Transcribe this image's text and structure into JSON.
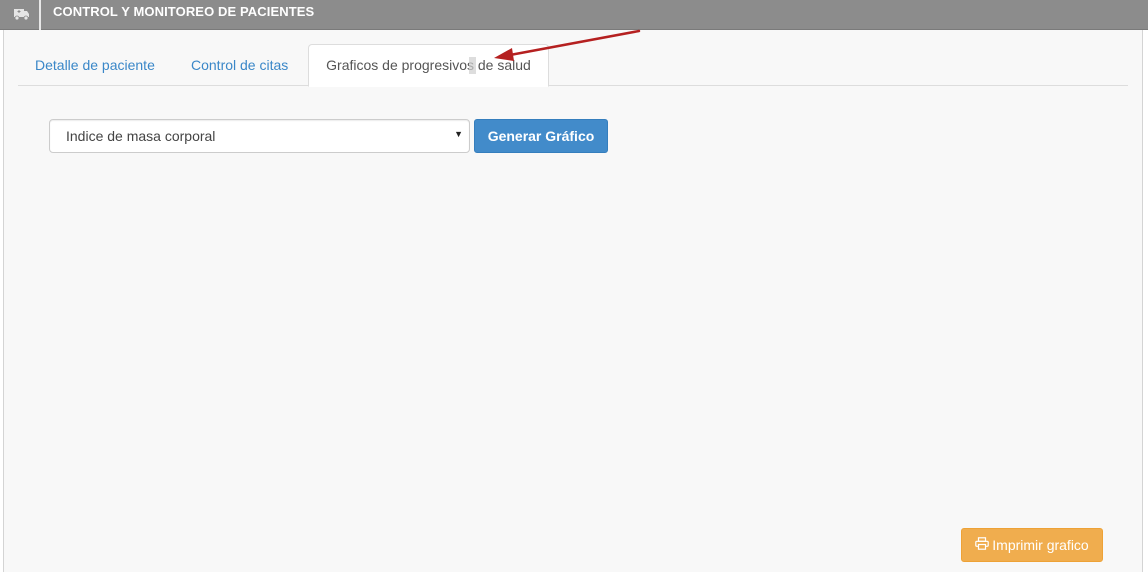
{
  "header": {
    "title": "CONTROL Y MONITOREO DE PACIENTES",
    "icon": "ambulance-icon"
  },
  "tabs": [
    {
      "label": "Detalle de paciente",
      "active": false
    },
    {
      "label": "Control de citas",
      "active": false
    },
    {
      "label": "Graficos de progresivos de salud",
      "active": true
    }
  ],
  "chart_selector": {
    "selected": "Indice de masa corporal"
  },
  "actions": {
    "generate_label": "Generar Gráfico",
    "print_label": "Imprimir grafico",
    "print_icon": "print-icon"
  },
  "colors": {
    "header_bg": "#8c8c8c",
    "primary": "#428bca",
    "warning": "#f0ad4e",
    "link": "#3a87c8",
    "annotation_arrow": "#b52020"
  }
}
